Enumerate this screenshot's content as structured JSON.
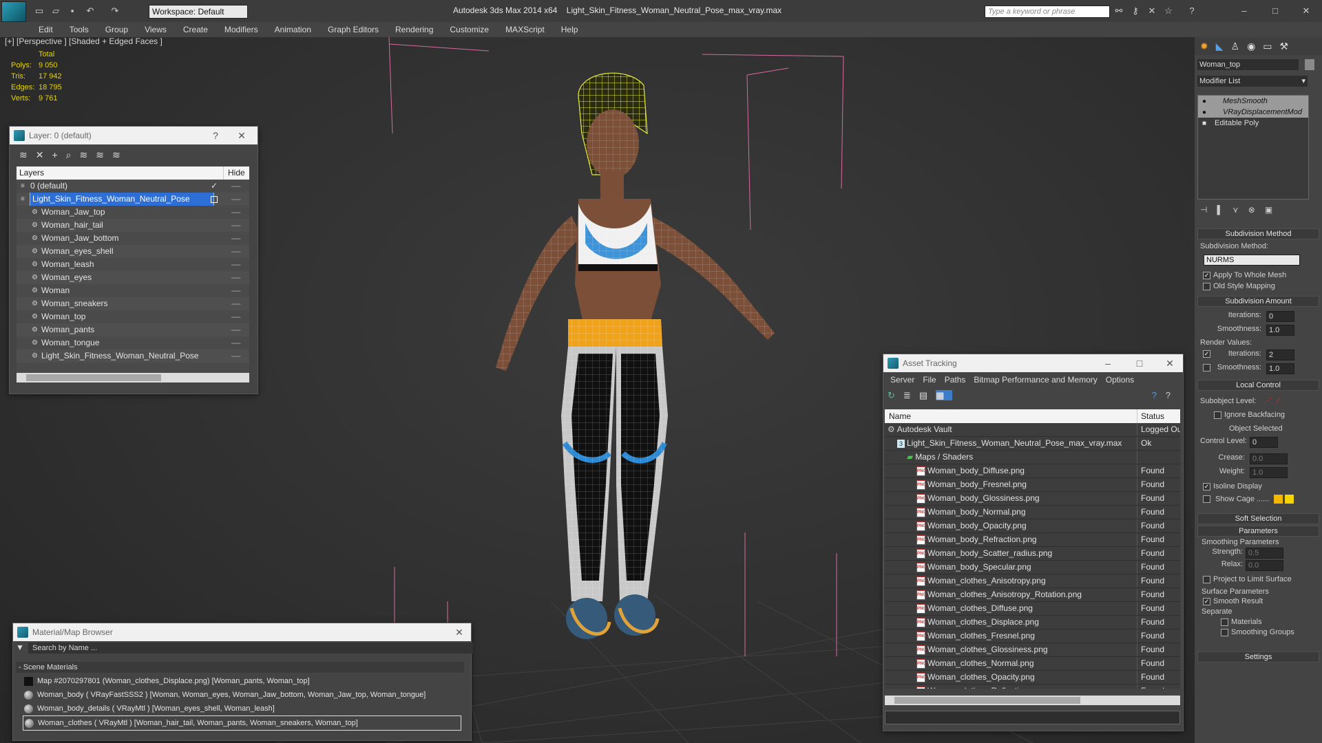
{
  "app": {
    "title": "Autodesk 3ds Max  2014 x64",
    "file": "Light_Skin_Fitness_Woman_Neutral_Pose_max_vray.max",
    "workspace": "Workspace: Default",
    "search_placeholder": "Type a keyword or phrase"
  },
  "menu": [
    "Edit",
    "Tools",
    "Group",
    "Views",
    "Create",
    "Modifiers",
    "Animation",
    "Graph Editors",
    "Rendering",
    "Customize",
    "MAXScript",
    "Help"
  ],
  "viewport": {
    "label": "[+] [Perspective ] [Shaded + Edged Faces ]",
    "stats": {
      "header": "Total",
      "rows": [
        {
          "label": "Polys:",
          "value": "9 050"
        },
        {
          "label": "Tris:",
          "value": "17 942"
        },
        {
          "label": "Edges:",
          "value": "18 795"
        },
        {
          "label": "Verts:",
          "value": "9 761"
        }
      ]
    }
  },
  "layer_window": {
    "title": "Layer: 0 (default)",
    "help": "?",
    "columns": {
      "layers": "Layers",
      "hide": "Hide"
    },
    "items": [
      {
        "name": "0 (default)",
        "level": 0
      },
      {
        "name": "Light_Skin_Fitness_Woman_Neutral_Pose",
        "level": 0,
        "selected": true
      },
      {
        "name": "Woman_Jaw_top",
        "level": 1
      },
      {
        "name": "Woman_hair_tail",
        "level": 1
      },
      {
        "name": "Woman_Jaw_bottom",
        "level": 1
      },
      {
        "name": "Woman_eyes_shell",
        "level": 1
      },
      {
        "name": "Woman_leash",
        "level": 1
      },
      {
        "name": "Woman_eyes",
        "level": 1
      },
      {
        "name": "Woman",
        "level": 1
      },
      {
        "name": "Woman_sneakers",
        "level": 1
      },
      {
        "name": "Woman_top",
        "level": 1
      },
      {
        "name": "Woman_pants",
        "level": 1
      },
      {
        "name": "Woman_tongue",
        "level": 1
      },
      {
        "name": "Light_Skin_Fitness_Woman_Neutral_Pose",
        "level": 1
      }
    ]
  },
  "material_browser": {
    "title": "Material/Map Browser",
    "search_placeholder": "Search by Name ...",
    "group": "- Scene Materials",
    "items": [
      "Map #2070297801 (Woman_clothes_Displace.png)  [Woman_pants, Woman_top]",
      "Woman_body  ( VRayFastSSS2 )  [Woman, Woman_eyes, Woman_Jaw_bottom, Woman_Jaw_top, Woman_tongue]",
      "Woman_body_details  ( VRayMtl )  [Woman_eyes_shell, Woman_leash]",
      "Woman_clothes  ( VRayMtl )  [Woman_hair_tail, Woman_pants, Woman_sneakers, Woman_top]"
    ]
  },
  "asset_tracking": {
    "title": "Asset Tracking",
    "menu": [
      "Server",
      "File",
      "Paths",
      "Bitmap Performance and Memory",
      "Options"
    ],
    "columns": {
      "name": "Name",
      "status": "Status"
    },
    "rows": [
      {
        "name": "Autodesk Vault",
        "status": "Logged Ou",
        "indent": 0,
        "type": "vault"
      },
      {
        "name": "Light_Skin_Fitness_Woman_Neutral_Pose_max_vray.max",
        "status": "Ok",
        "indent": 1,
        "type": "max"
      },
      {
        "name": "Maps / Shaders",
        "status": "",
        "indent": 2,
        "type": "folder"
      },
      {
        "name": "Woman_body_Diffuse.png",
        "status": "Found",
        "indent": 3,
        "type": "png"
      },
      {
        "name": "Woman_body_Fresnel.png",
        "status": "Found",
        "indent": 3,
        "type": "png"
      },
      {
        "name": "Woman_body_Glossiness.png",
        "status": "Found",
        "indent": 3,
        "type": "png"
      },
      {
        "name": "Woman_body_Normal.png",
        "status": "Found",
        "indent": 3,
        "type": "png"
      },
      {
        "name": "Woman_body_Opacity.png",
        "status": "Found",
        "indent": 3,
        "type": "png"
      },
      {
        "name": "Woman_body_Refraction.png",
        "status": "Found",
        "indent": 3,
        "type": "png"
      },
      {
        "name": "Woman_body_Scatter_radius.png",
        "status": "Found",
        "indent": 3,
        "type": "png"
      },
      {
        "name": "Woman_body_Specular.png",
        "status": "Found",
        "indent": 3,
        "type": "png"
      },
      {
        "name": "Woman_clothes_Anisotropy.png",
        "status": "Found",
        "indent": 3,
        "type": "png"
      },
      {
        "name": "Woman_clothes_Anisotropy_Rotation.png",
        "status": "Found",
        "indent": 3,
        "type": "png"
      },
      {
        "name": "Woman_clothes_Diffuse.png",
        "status": "Found",
        "indent": 3,
        "type": "png"
      },
      {
        "name": "Woman_clothes_Displace.png",
        "status": "Found",
        "indent": 3,
        "type": "png"
      },
      {
        "name": "Woman_clothes_Fresnel.png",
        "status": "Found",
        "indent": 3,
        "type": "png"
      },
      {
        "name": "Woman_clothes_Glossiness.png",
        "status": "Found",
        "indent": 3,
        "type": "png"
      },
      {
        "name": "Woman_clothes_Normal.png",
        "status": "Found",
        "indent": 3,
        "type": "png"
      },
      {
        "name": "Woman_clothes_Opacity.png",
        "status": "Found",
        "indent": 3,
        "type": "png"
      },
      {
        "name": "Woman_clothes_Reflection.png",
        "status": "Found",
        "indent": 3,
        "type": "png"
      }
    ]
  },
  "command_panel": {
    "object_name": "Woman_top",
    "modifier_list": "Modifier List",
    "stack": [
      "MeshSmooth",
      "VRayDisplacementMod",
      "Editable Poly"
    ],
    "subdivision_method": {
      "header": "Subdivision Method",
      "label": "Subdivision Method:",
      "value": "NURMS",
      "apply_whole_mesh": "Apply To Whole Mesh",
      "old_style": "Old Style Mapping"
    },
    "subdivision_amount": {
      "header": "Subdivision Amount",
      "iterations_label": "Iterations:",
      "iterations": "0",
      "smoothness_label": "Smoothness:",
      "smoothness": "1.0",
      "render_values": "Render Values:",
      "r_iterations_label": "Iterations:",
      "r_iterations": "2",
      "r_smoothness_label": "Smoothness:",
      "r_smoothness": "1.0"
    },
    "local_control": {
      "header": "Local Control",
      "subobject": "Subobject Level:",
      "ignore_backfacing": "Ignore Backfacing",
      "object_selected": "Object Selected",
      "control_level_label": "Control Level:",
      "control_level": "0",
      "crease_label": "Crease:",
      "crease": "0.0",
      "weight_label": "Weight:",
      "weight": "1.0",
      "isoline": "Isoline Display",
      "show_cage": "Show Cage ......"
    },
    "soft_selection": "Soft Selection",
    "parameters": {
      "header": "Parameters",
      "smoothing": "Smoothing Parameters",
      "strength_label": "Strength:",
      "strength": "0.5",
      "relax_label": "Relax:",
      "relax": "0.0",
      "project": "Project to Limit Surface",
      "surface": "Surface Parameters",
      "smooth_result": "Smooth Result",
      "separate": "Separate",
      "materials": "Materials",
      "smoothing_groups": "Smoothing Groups"
    },
    "settings": "Settings"
  }
}
